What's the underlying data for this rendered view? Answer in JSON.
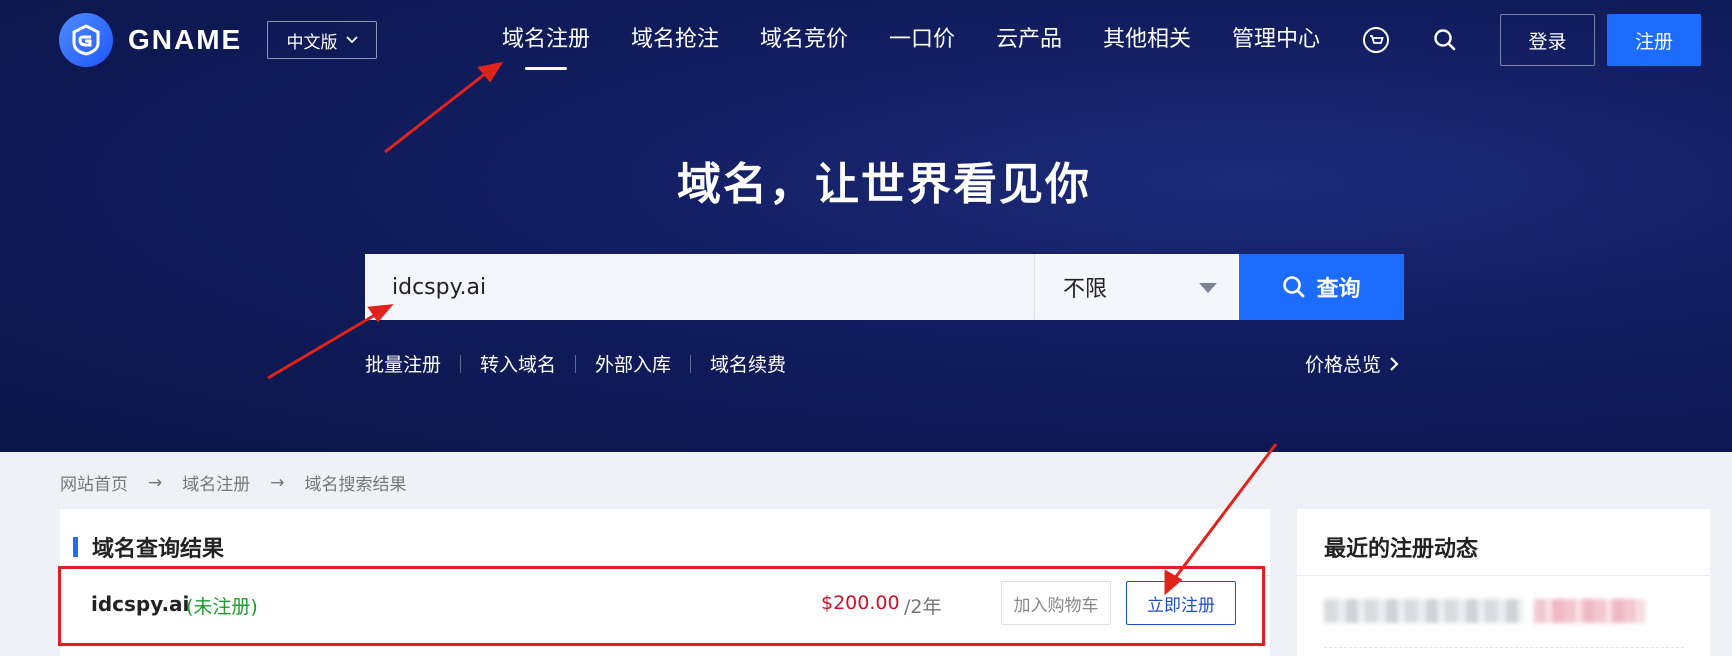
{
  "brand": {
    "name": "GNAME"
  },
  "language": {
    "label": "中文版"
  },
  "nav": {
    "items": [
      {
        "label": "域名注册"
      },
      {
        "label": "域名抢注"
      },
      {
        "label": "域名竞价"
      },
      {
        "label": "一口价"
      },
      {
        "label": "云产品"
      },
      {
        "label": "其他相关"
      },
      {
        "label": "管理中心"
      }
    ],
    "cart_icon": "cart-icon",
    "search_icon": "search-icon"
  },
  "auth": {
    "login": "登录",
    "register": "注册"
  },
  "hero": {
    "title": "域名，让世界看见你"
  },
  "search": {
    "value": "idcspy.ai",
    "suffix_select": "不限",
    "button": "查询"
  },
  "quick_links": [
    "批量注册",
    "转入域名",
    "外部入库",
    "域名续费"
  ],
  "price_overview": "价格总览",
  "breadcrumb": [
    "网站首页",
    "域名注册",
    "域名搜索结果"
  ],
  "results": {
    "title": "域名查询结果",
    "row": {
      "domain": "idcspy.ai",
      "status": "(未注册)",
      "price": "$200.00",
      "period": "/2年",
      "add_to_cart": "加入购物车",
      "register_now": "立即注册"
    }
  },
  "recent": {
    "title": "最近的注册动态"
  },
  "colors": {
    "accent": "#1b6cff",
    "hero_bg": "#111c5e",
    "price": "#d0102a",
    "status_available": "#1f9a2e",
    "highlight": "#e02020"
  }
}
